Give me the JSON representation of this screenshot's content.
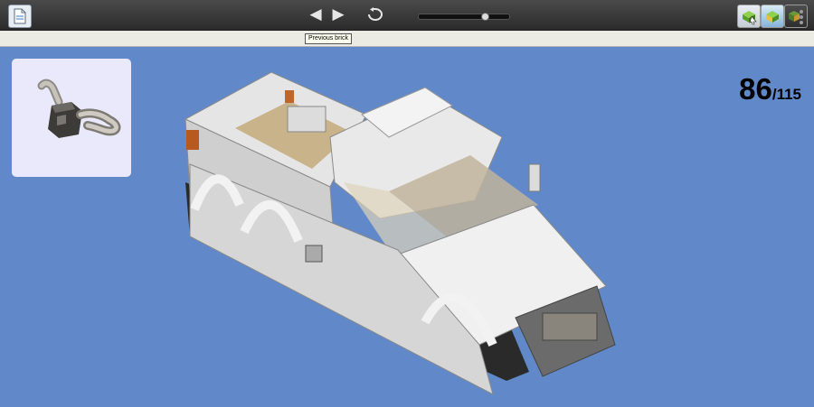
{
  "toolbar": {
    "document_icon": "document-icon",
    "prev_glyph": "◀",
    "next_glyph": "▶",
    "undo_icon": "undo-arrow-icon",
    "view_icons": [
      "build-mode-icon",
      "assembled-view-icon",
      "dark-view-icon"
    ]
  },
  "tooltip": {
    "text": "Previous brick"
  },
  "part_panel": {
    "icon": "current-brick-preview-icon"
  },
  "counter": {
    "current": "86",
    "total": "/115"
  },
  "colors": {
    "background": "#6189c9",
    "toolbar": "#333333",
    "panel": "#e9e9fb"
  }
}
